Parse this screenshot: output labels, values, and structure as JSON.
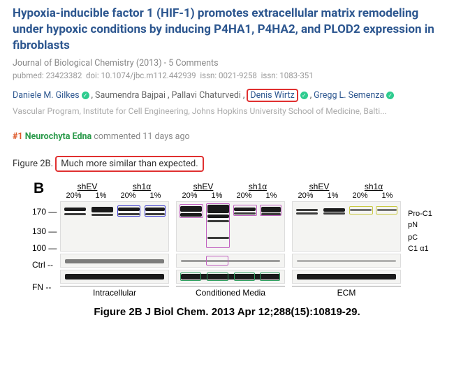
{
  "title": "Hypoxia-inducible factor 1 (HIF-1) promotes extracellular matrix remodeling under hypoxic conditions by inducing P4HA1, P4HA2, and PLOD2 expression in fibroblasts",
  "journal": {
    "name": "Journal of Biological Chemistry",
    "year": "(2013)",
    "comments": "5 Comments"
  },
  "ids": {
    "pubmed_label": "pubmed:",
    "pubmed": "23423382",
    "doi_label": "doi:",
    "doi": "10.1074/jbc.m112.442939",
    "issn1_label": "issn:",
    "issn1": "0021-9258",
    "issn2_label": "issn:",
    "issn2": "1083-351"
  },
  "authors": [
    {
      "name": "Daniele M. Gilkes",
      "verified": true,
      "link": true
    },
    {
      "name": "Saumendra Bajpai",
      "verified": false,
      "link": false
    },
    {
      "name": "Pallavi Chaturvedi",
      "verified": false,
      "link": false
    },
    {
      "name": "Denis Wirtz",
      "verified": true,
      "link": true,
      "highlight": true
    },
    {
      "name": "Gregg L. Semenza",
      "verified": true,
      "link": true
    }
  ],
  "affil": "Vascular Program, Institute for Cell Engineering, Johns Hopkins University School of Medicine, Balti...",
  "comment": {
    "num": "#1",
    "user": "Neurochyta Edna",
    "meta": "commented 11 days ago"
  },
  "figline": {
    "prefix": "Figure 2B.",
    "note": "Much more similar than expected."
  },
  "blotlabels": {
    "shEV": "shEV",
    "sh1a": "sh1α",
    "p20": "20%",
    "p1": "1%",
    "mw170": "170",
    "mw130": "130",
    "mw100": "100",
    "ctrl": "Ctrl --",
    "fn": "FN --",
    "intra": "Intracellular",
    "cond": "Conditioned Media",
    "ecm": "ECM",
    "proc1": "Pro-C1",
    "pn": "pN",
    "pc": "pC",
    "c1a1": "C1 α1",
    "B": "B",
    "dash": "—"
  },
  "caption": "Figure 2B J Biol Chem. 2013 Apr 12;288(15):10819-29."
}
